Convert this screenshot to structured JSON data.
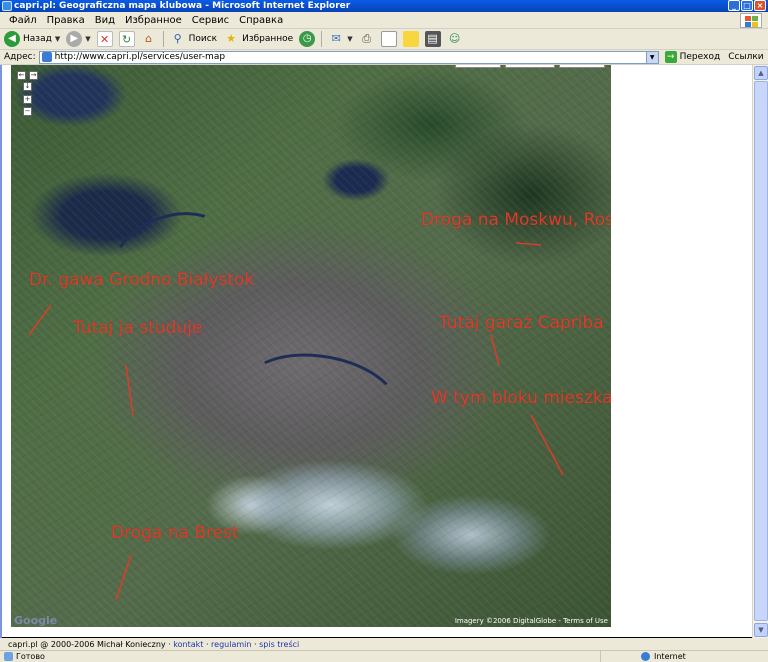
{
  "window": {
    "title": "capri.pl: Geograficzna mapa klubowa - Microsoft Internet Explorer",
    "min": "_",
    "max": "□",
    "close": "×"
  },
  "menu": {
    "items": [
      "Файл",
      "Правка",
      "Вид",
      "Избранное",
      "Сервис",
      "Справка"
    ]
  },
  "toolbar": {
    "back_label": "Назад",
    "search_label": "Поиск",
    "favorites_label": "Избранное"
  },
  "address": {
    "label": "Адрес:",
    "url": "http://www.capri.pl/services/user-map",
    "go_label": "Переход",
    "links_label": "Ссылки"
  },
  "map": {
    "annotations": [
      "Droga na Moskwu, Rossyju.",
      "Dr. gawa Grodno Białystok",
      "Tutaj ja studuje",
      "Tutaj garaż Capriba",
      "W tym bloku mieszkam",
      "Droga na Brest"
    ],
    "controls": {
      "left": "←",
      "right": "→",
      "down": "↓",
      "zoom_in": "+",
      "zoom_out": "−"
    },
    "google_logo": "Google",
    "imagery_credit": "Imagery ©2006 DigitalGlobe - Terms of Use"
  },
  "footer": {
    "copyright": "capri.pl @ 2000-2006 Michał Konieczny",
    "sep1": " · ",
    "kontakt": "kontakt",
    "sep2": " · ",
    "regulamin": "regulamin",
    "sep3": " · ",
    "spis": "spis treści"
  },
  "status": {
    "text": "Готово",
    "zone": "Internet"
  }
}
